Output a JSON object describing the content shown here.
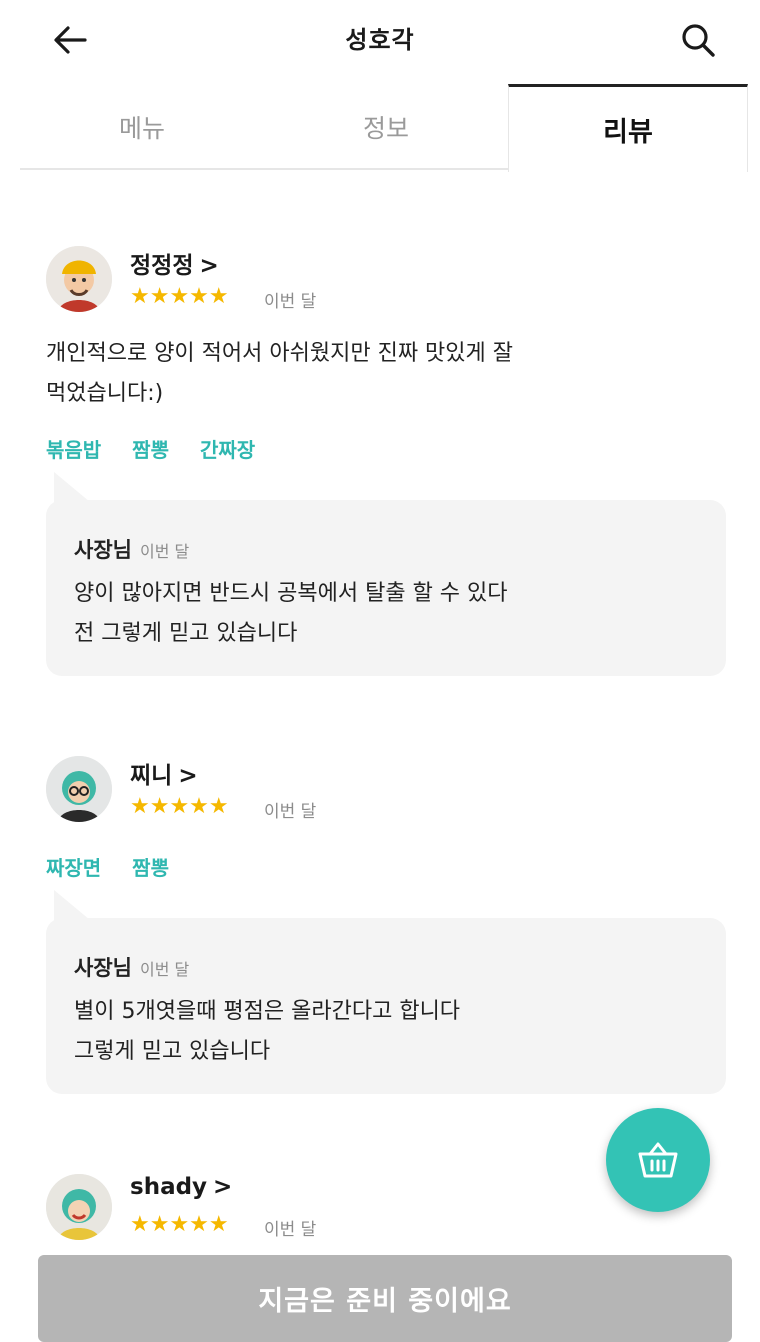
{
  "header": {
    "title": "성호각",
    "back_icon": "arrow-left-icon",
    "search_icon": "search-icon"
  },
  "tabs": [
    {
      "label": "메뉴",
      "active": false
    },
    {
      "label": "정보",
      "active": false
    },
    {
      "label": "리뷰",
      "active": true
    }
  ],
  "reviews": [
    {
      "name": "정정정",
      "chevron": ">",
      "stars": "★★★★★",
      "rating": 5,
      "date": "이번 달",
      "text_lines": [
        "개인적으로 양이 적어서 아쉬웠지만 진짜 맛있게 잘",
        "먹었습니다:)"
      ],
      "tags": [
        "볶음밥",
        "짬뽕",
        "간짜장"
      ],
      "owner_reply": {
        "author": "사장님",
        "date": "이번 달",
        "lines": [
          "양이 많아지면 반드시 공복에서 탈출 할 수 있다",
          "전 그렇게 믿고 있습니다"
        ]
      }
    },
    {
      "name": "찌니",
      "chevron": ">",
      "stars": "★★★★★",
      "rating": 5,
      "date": "이번 달",
      "tags": [
        "짜장면",
        "짬뽕"
      ],
      "owner_reply": {
        "author": "사장님",
        "date": "이번 달",
        "lines": [
          "별이 5개엿을때 평점은 올라간다고 합니다",
          "그렇게 믿고 있습니다"
        ]
      }
    },
    {
      "name": "shady",
      "chevron": ">",
      "stars": "★★★★★",
      "rating": 5,
      "date": "이번 달"
    }
  ],
  "fab": {
    "icon": "basket-icon"
  },
  "bottom_button": {
    "label": "지금은 준비 중이에요"
  },
  "colors": {
    "accent": "#33c3b5",
    "tag": "#2fb7b0",
    "star": "#f5b800",
    "disabled": "#b5b5b5"
  }
}
